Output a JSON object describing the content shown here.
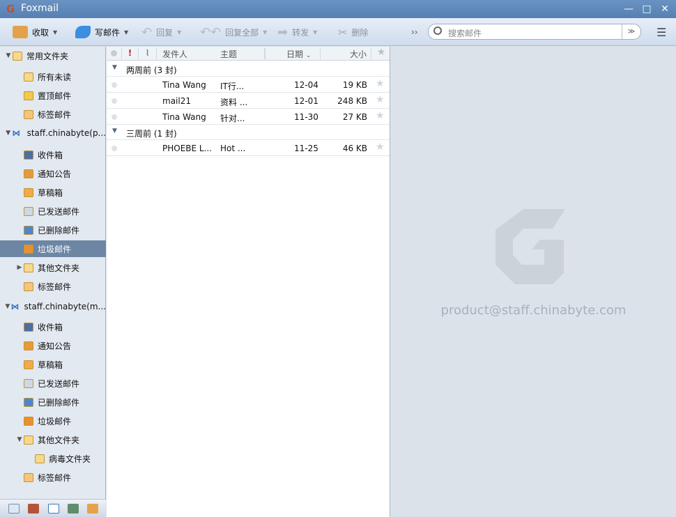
{
  "window": {
    "title": "Foxmail",
    "minimize": "—",
    "maximize": "□",
    "close": "✕"
  },
  "toolbar": {
    "receive": "收取",
    "compose": "写邮件",
    "reply": "回复",
    "reply_all": "回复全部",
    "forward": "转发",
    "delete": "删除",
    "more": "››",
    "search_placeholder": "搜索邮件",
    "dropdown": "≫",
    "menu": "☰"
  },
  "sidebar": {
    "items": [
      {
        "label": "常用文件夹",
        "level": 0,
        "tri": "▼",
        "kind": "folder"
      },
      {
        "label": "所有未读",
        "level": 1,
        "kind": "folder"
      },
      {
        "label": "置顶邮件",
        "level": 1,
        "kind": "star"
      },
      {
        "label": "标签邮件",
        "level": 1,
        "kind": "tag"
      },
      {
        "label": "staff.chinabyte(p...",
        "level": 0,
        "tri": "▼",
        "kind": "account"
      },
      {
        "label": "收件箱",
        "level": 1,
        "kind": "inbox"
      },
      {
        "label": "通知公告",
        "level": 1,
        "kind": "notice"
      },
      {
        "label": "草稿箱",
        "level": 1,
        "kind": "draft"
      },
      {
        "label": "已发送邮件",
        "level": 1,
        "kind": "sent"
      },
      {
        "label": "已删除邮件",
        "level": 1,
        "kind": "trash"
      },
      {
        "label": "垃圾邮件",
        "level": 1,
        "kind": "spam",
        "selected": true
      },
      {
        "label": "其他文件夹",
        "level": 1,
        "tri": "▶",
        "kind": "folder"
      },
      {
        "label": "标签邮件",
        "level": 1,
        "kind": "tag"
      },
      {
        "label": "staff.chinabyte(m...",
        "level": 0,
        "tri": "▼",
        "kind": "account"
      },
      {
        "label": "收件箱",
        "level": 1,
        "kind": "inbox"
      },
      {
        "label": "通知公告",
        "level": 1,
        "kind": "notice"
      },
      {
        "label": "草稿箱",
        "level": 1,
        "kind": "draft"
      },
      {
        "label": "已发送邮件",
        "level": 1,
        "kind": "sent"
      },
      {
        "label": "已删除邮件",
        "level": 1,
        "kind": "trash"
      },
      {
        "label": "垃圾邮件",
        "level": 1,
        "kind": "spam"
      },
      {
        "label": "其他文件夹",
        "level": 1,
        "tri": "▼",
        "kind": "folder"
      },
      {
        "label": "病毒文件夹",
        "level": 2,
        "kind": "folder"
      },
      {
        "label": "标签邮件",
        "level": 1,
        "kind": "tag"
      }
    ]
  },
  "list": {
    "columns": {
      "flag": "!",
      "sender": "发件人",
      "subject": "主题",
      "date": "日期",
      "size": "大小"
    },
    "groups": [
      {
        "label": "两周前 (3 封)",
        "rows": [
          {
            "sender": "Tina Wang",
            "subject": "IT行...",
            "date": "12-04",
            "size": "19 KB"
          },
          {
            "sender": "mail21",
            "subject": "资料 ...",
            "date": "12-01",
            "size": "248 KB"
          },
          {
            "sender": "Tina Wang",
            "subject": "针对...",
            "date": "11-30",
            "size": "27 KB"
          }
        ]
      },
      {
        "label": "三周前 (1 封)",
        "rows": [
          {
            "sender": "PHOEBE L...",
            "subject": "Hot ...",
            "date": "11-25",
            "size": "46 KB"
          }
        ]
      }
    ]
  },
  "preview": {
    "account": "product@staff.chinabyte.com"
  },
  "colors": {
    "title": "#5b86b8",
    "selected": "#6c86a4",
    "preview_bg": "#dce2e9"
  }
}
